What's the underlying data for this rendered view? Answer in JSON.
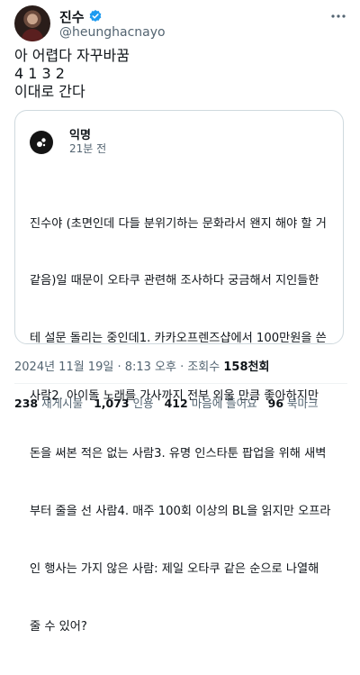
{
  "author": {
    "name": "진수",
    "handle": "@heunghacnayo"
  },
  "tweet": {
    "lines": [
      "아 어렵다 자꾸바꿈",
      "4 1 3 2",
      "이대로 간다"
    ]
  },
  "quote": {
    "name": "익명",
    "time": "21분 전",
    "body_lines": [
      "진수야 (초면인데 다들 분위기하는 문화라서 왠지 해야 할 거",
      "같음)일 때문이 오타쿠 관련해 조사하다 궁금해서 지인들한",
      "테 설문 돌리는 중인데1. 카카오프렌즈샵에서 100만원을 쓴",
      "사람2. 아이돌 노래를 가사까지 전부 외울 만큼 좋아하지만",
      "돈을 써본 적은 없는 사람3. 유명 인스타툰 팝업을 위해 새벽",
      "부터 줄을 선 사람4. 매주 100회 이상의 BL을 읽지만 오프라",
      "인 행사는 가지 않은 사람: 제일 오타쿠 같은 순으로 나열해",
      "줄 수 있어?"
    ]
  },
  "meta": {
    "datetime": "2024년 11월 19일 · 8:13 오후 · 조회수 ",
    "views": "158천회"
  },
  "stats": {
    "retweets_count": "238",
    "retweets_label": "재게시물",
    "quotes_count": "1,073",
    "quotes_label": "인용",
    "likes_count": "412",
    "likes_label": "마음에 들어요",
    "bookmarks_count": "96",
    "bookmarks_label": "북마크"
  },
  "colors": {
    "verified": "#1d9bf0",
    "muted": "#536471",
    "border": "#cfd9de"
  }
}
